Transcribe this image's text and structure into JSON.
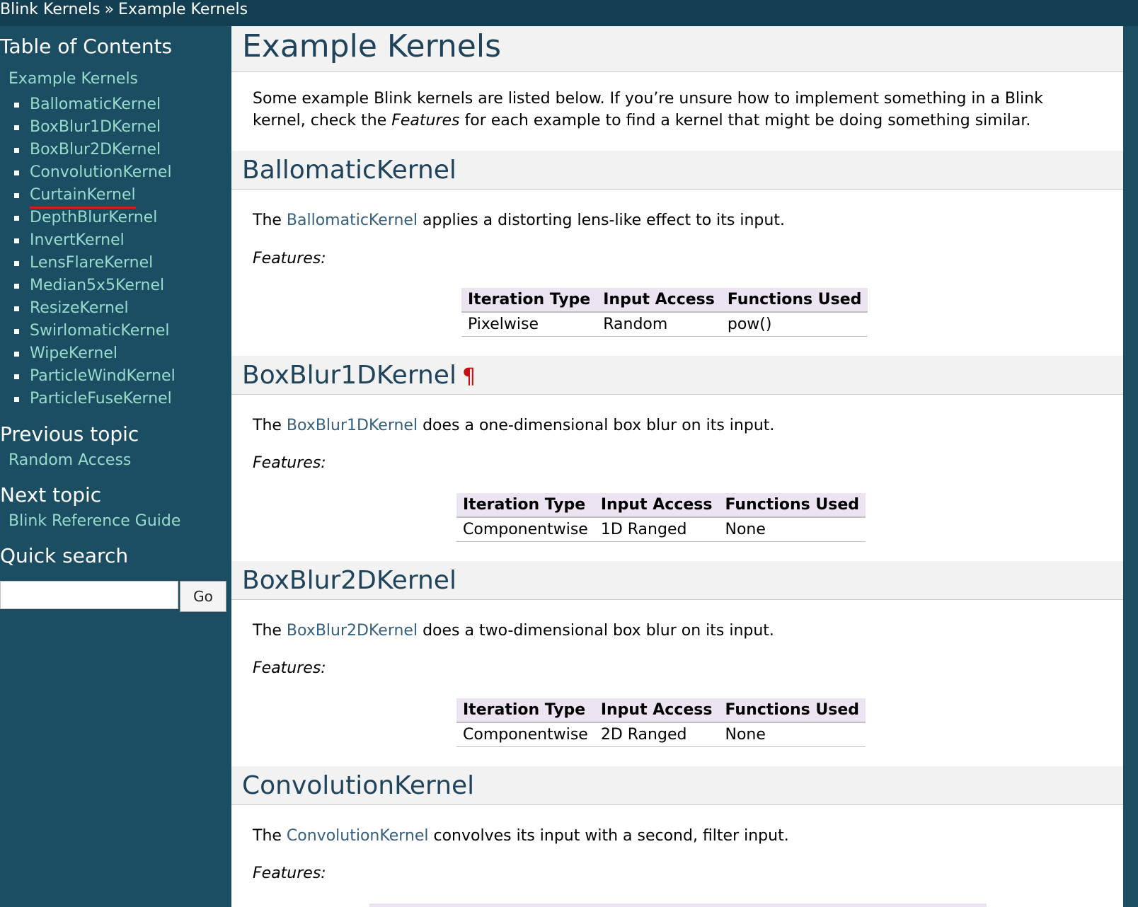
{
  "breadcrumb": {
    "root": "Blink Kernels",
    "separator": "»",
    "current": "Example Kernels"
  },
  "sidebar": {
    "toc_title": "Table of Contents",
    "toc_root": "Example Kernels",
    "toc_items": [
      "BallomaticKernel",
      "BoxBlur1DKernel",
      "BoxBlur2DKernel",
      "ConvolutionKernel",
      "CurtainKernel",
      "DepthBlurKernel",
      "InvertKernel",
      "LensFlareKernel",
      "Median5x5Kernel",
      "ResizeKernel",
      "SwirlomaticKernel",
      "WipeKernel",
      "ParticleWindKernel",
      "ParticleFuseKernel"
    ],
    "previous_title": "Previous topic",
    "previous_link": "Random Access",
    "next_title": "Next topic",
    "next_link": "Blink Reference Guide",
    "search_title": "Quick search",
    "search_value": "",
    "go_label": "Go"
  },
  "main": {
    "title": "Example Kernels",
    "intro_line1": "Some example Blink kernels are listed below. If you’re unsure how to implement something in a Blink",
    "intro_line2_pre": "kernel, check the ",
    "intro_line2_em": "Features",
    "intro_line2_post": " for each example to find a kernel that might be doing something similar.",
    "features_label": "Features:",
    "table_headers": [
      "Iteration Type",
      "Input Access",
      "Functions Used"
    ],
    "sections": [
      {
        "title": "BallomaticKernel",
        "pilcrow": "",
        "desc_pre": "The ",
        "desc_link": "BallomaticKernel",
        "desc_post": " applies a distorting lens-like effect to its input.",
        "row": [
          "Pixelwise",
          "Random",
          "pow()"
        ]
      },
      {
        "title": "BoxBlur1DKernel",
        "pilcrow": "¶",
        "desc_pre": "The ",
        "desc_link": "BoxBlur1DKernel",
        "desc_post": " does a one-dimensional box blur on its input.",
        "row": [
          "Componentwise",
          "1D Ranged",
          "None"
        ]
      },
      {
        "title": "BoxBlur2DKernel",
        "pilcrow": "",
        "desc_pre": "The ",
        "desc_link": "BoxBlur2DKernel",
        "desc_post": " does a two-dimensional box blur on its input.",
        "row": [
          "Componentwise",
          "2D Ranged",
          "None"
        ]
      },
      {
        "title": "ConvolutionKernel",
        "pilcrow": "",
        "desc_pre": "The ",
        "desc_link": "ConvolutionKernel",
        "desc_post": " convolves its input with a second, filter input."
      }
    ]
  }
}
